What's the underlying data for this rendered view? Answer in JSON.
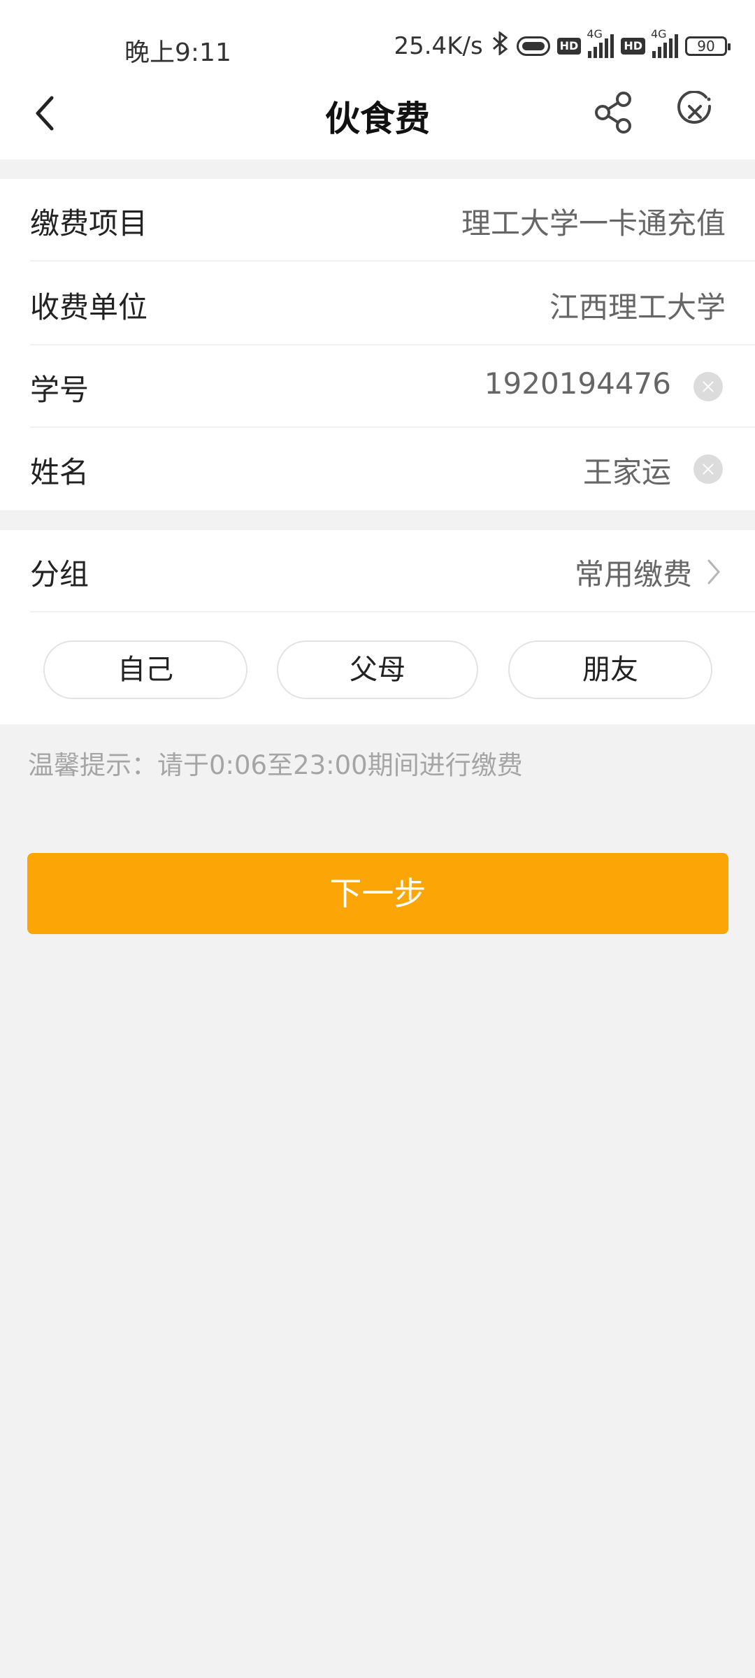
{
  "status_bar": {
    "time": "晚上9:11",
    "net_speed": "25.4K/s",
    "bluetooth_icon": "bluetooth-icon",
    "hd1": "HD",
    "sig1_label": "4G",
    "hd2": "HD",
    "sig2_label": "4G",
    "battery": "90"
  },
  "header": {
    "title": "伙食费",
    "back_icon": "chevron-left-icon",
    "share_icon": "share-icon",
    "close_icon": "close-circle-icon"
  },
  "form": {
    "rows": [
      {
        "label": "缴费项目",
        "value": "理工大学一卡通充值"
      },
      {
        "label": "收费单位",
        "value": "江西理工大学"
      },
      {
        "label": "学号",
        "value": "1920194476"
      },
      {
        "label": "姓名",
        "value": "王家运"
      }
    ]
  },
  "group": {
    "label": "分组",
    "value": "常用缴费",
    "options": [
      "自己",
      "父母",
      "朋友"
    ]
  },
  "hint": "温馨提示：请于0:06至23:00期间进行缴费",
  "next_button": "下一步",
  "colors": {
    "accent": "#fba507",
    "background": "#f2f2f2"
  }
}
